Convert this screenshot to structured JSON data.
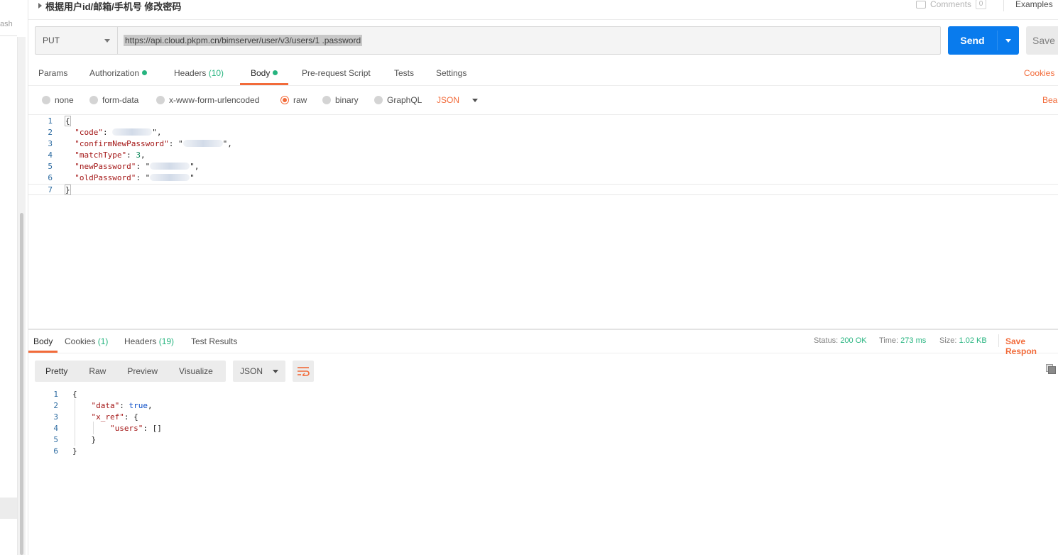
{
  "sidebar": {
    "partial_text": "ash"
  },
  "header": {
    "title": "根据用户id/邮箱/手机号 修改密码",
    "comments_label": "Comments",
    "comments_count": "0",
    "examples_label": "Examples"
  },
  "request": {
    "method": "PUT",
    "url": "https://api.cloud.pkpm.cn/bimserver/user/v3/users/1              .password",
    "send_label": "Send",
    "save_label": "Save"
  },
  "request_tabs": {
    "params": "Params",
    "authorization": "Authorization",
    "headers": "Headers",
    "headers_count": "(10)",
    "body": "Body",
    "prerequest": "Pre-request Script",
    "tests": "Tests",
    "settings": "Settings",
    "cookies": "Cookies"
  },
  "body_modes": {
    "none": "none",
    "form_data": "form-data",
    "urlencoded": "x-www-form-urlencoded",
    "raw": "raw",
    "binary": "binary",
    "graphql": "GraphQL",
    "format": "JSON",
    "beautify": "Bea"
  },
  "request_body": {
    "line_numbers": [
      "1",
      "2",
      "3",
      "4",
      "5",
      "6",
      "7"
    ],
    "open": "{",
    "close": "}",
    "code_key": "\"code\"",
    "confirm_key": "\"confirmNewPassword\"",
    "matchtype_key": "\"matchType\"",
    "matchtype_value": "3",
    "newpw_key": "\"newPassword\"",
    "oldpw_key": "\"oldPassword\""
  },
  "response_tabs": {
    "body": "Body",
    "cookies": "Cookies",
    "cookies_count": "(1)",
    "headers": "Headers",
    "headers_count": "(19)",
    "test_results": "Test Results",
    "status_label": "Status:",
    "status_value": "200 OK",
    "time_label": "Time:",
    "time_value": "273 ms",
    "size_label": "Size:",
    "size_value": "1.02 KB",
    "save_response": "Save Respon"
  },
  "response_toolbar": {
    "pretty": "Pretty",
    "raw": "Raw",
    "preview": "Preview",
    "visualize": "Visualize",
    "format": "JSON"
  },
  "response_body": {
    "line_numbers": [
      "1",
      "2",
      "3",
      "4",
      "5",
      "6"
    ],
    "open": "{",
    "data_key": "\"data\"",
    "data_value": "true",
    "xref_key": "\"x_ref\"",
    "users_key": "\"users\"",
    "users_value": "[]",
    "inner_close": "}",
    "close": "}"
  },
  "colors": {
    "accent_orange": "#f26b3a",
    "send_blue": "#097bed",
    "status_green": "#26b47f"
  }
}
